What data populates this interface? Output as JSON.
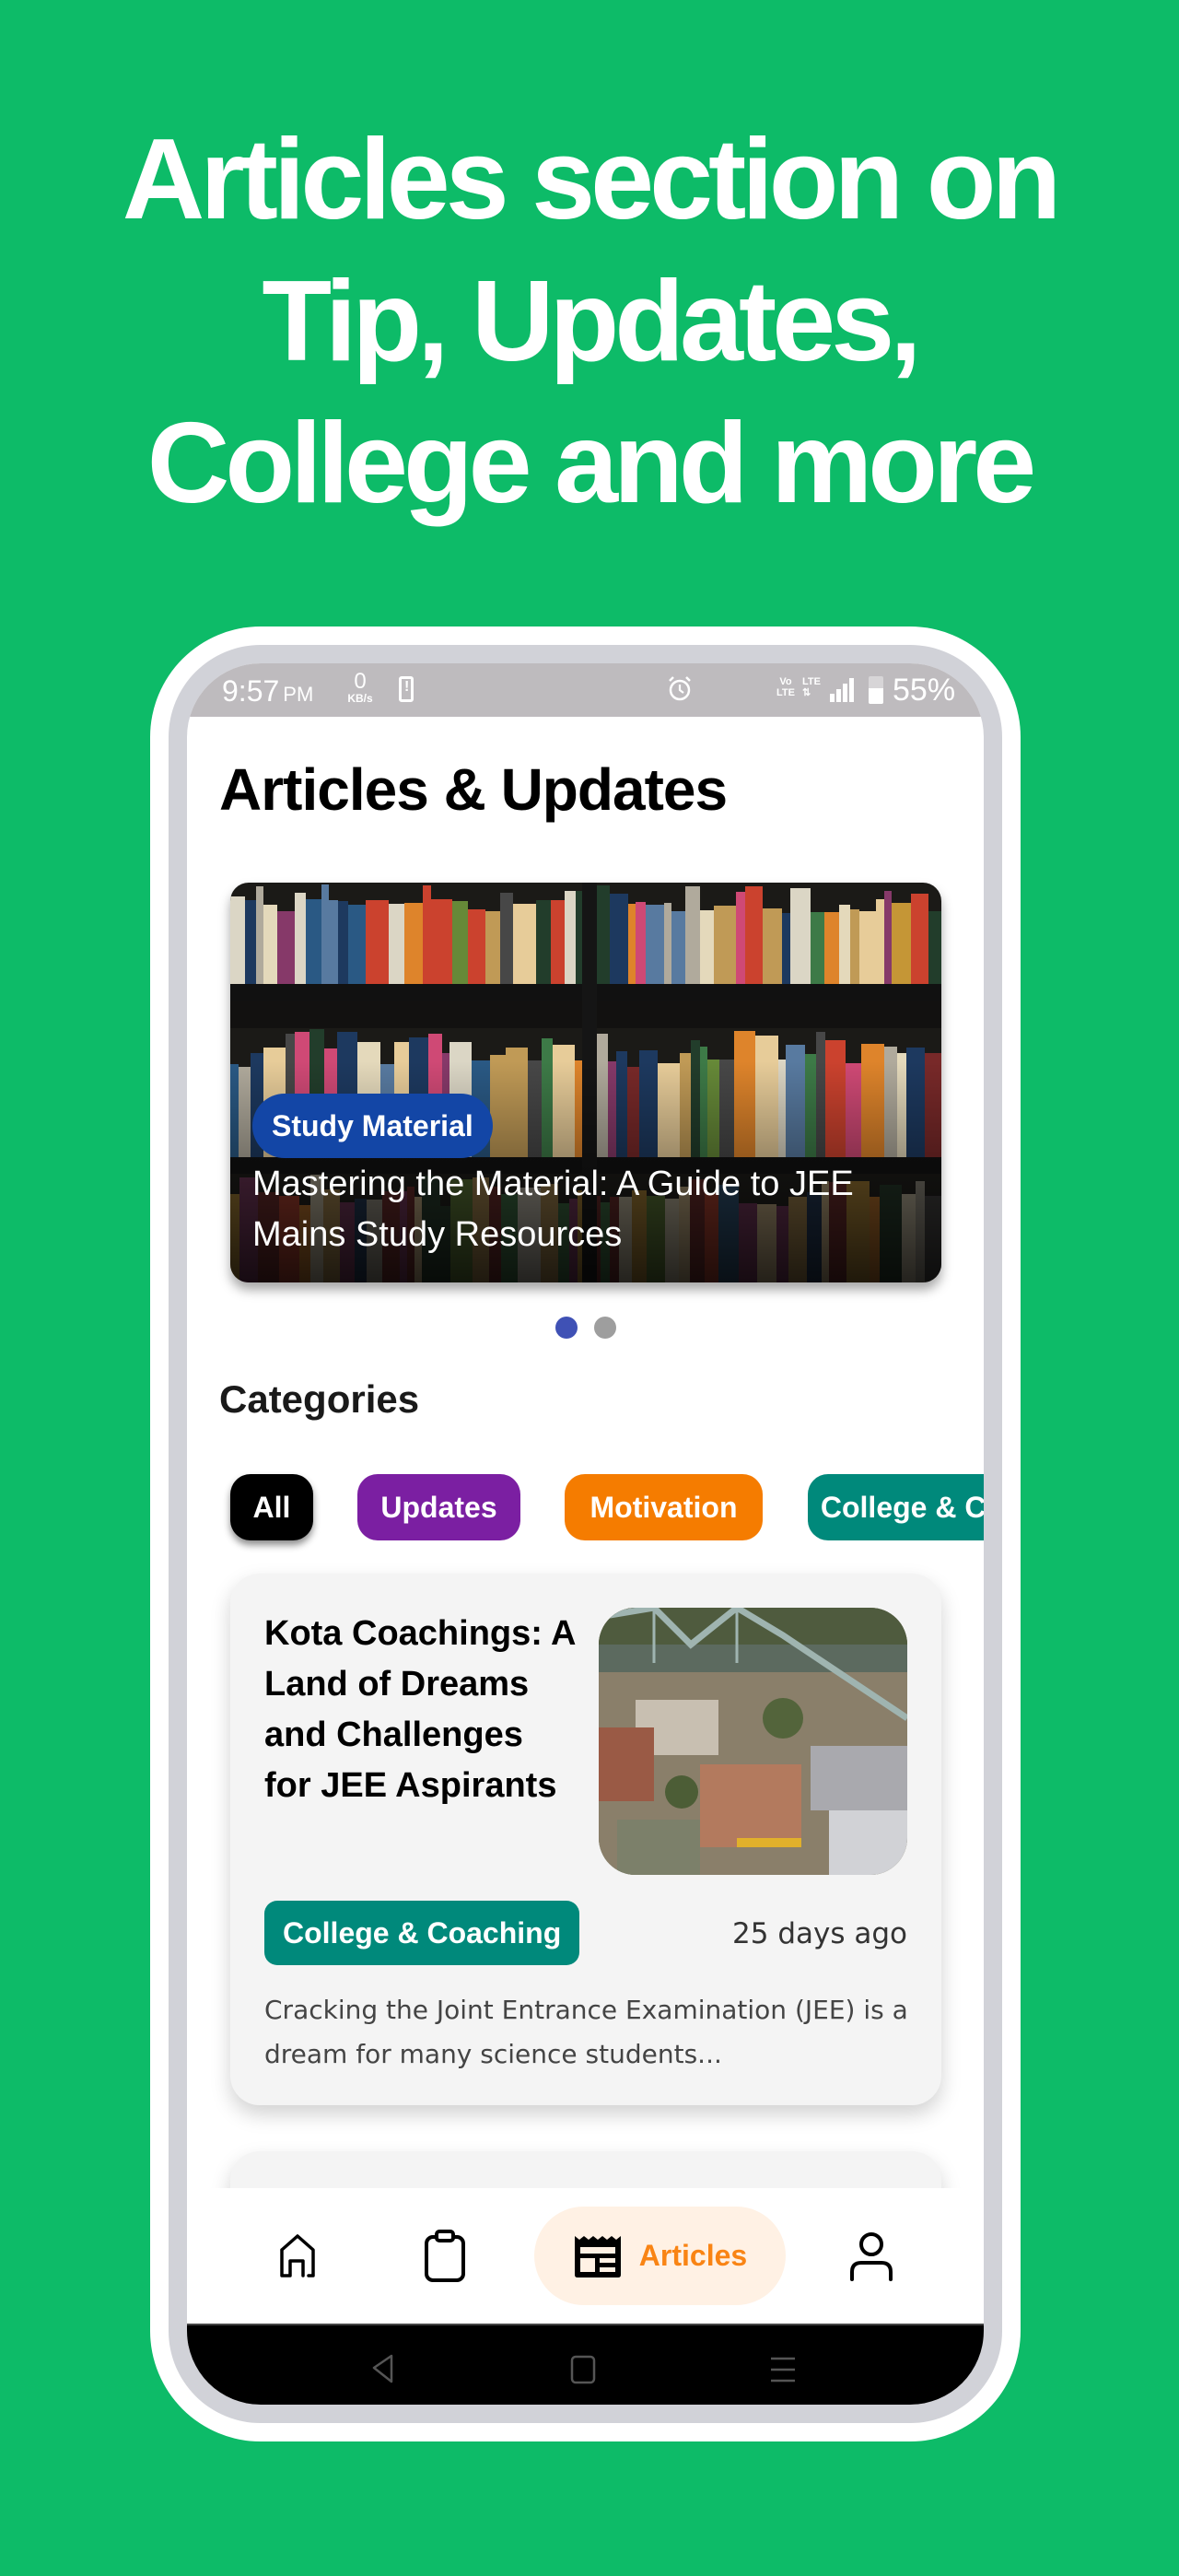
{
  "promo": {
    "headline_lines": [
      "Articles section on",
      "Tip, Updates,",
      "College and more"
    ]
  },
  "status_bar": {
    "time": "9:57",
    "ampm": "PM",
    "net_speed_value": "0",
    "net_speed_unit": "KB/s",
    "volte_top": "Vo",
    "volte_bottom": "LTE",
    "lte_label": "LTE",
    "battery_percent": "55%",
    "icons": [
      "phone-alert-icon",
      "alarm-icon",
      "volte-icon",
      "lte-data-icon",
      "signal-icon",
      "battery-icon"
    ]
  },
  "page": {
    "title": "Articles & Updates"
  },
  "carousel": {
    "slides": [
      {
        "category": "Study Material",
        "category_color": "#1346A6",
        "title_lines": [
          "Mastering the Material: A Guide to JEE",
          "Mains Study Resources"
        ]
      }
    ],
    "dot_count": 2,
    "active_index": 0
  },
  "categories": {
    "heading": "Categories",
    "items": [
      {
        "label": "All",
        "color": "#000000",
        "selected": true
      },
      {
        "label": "Updates",
        "color": "#7B1FA2",
        "selected": false
      },
      {
        "label": "Motivation",
        "color": "#F57C00",
        "selected": false
      },
      {
        "label": "College & Coaching",
        "color": "#00897B",
        "selected": false
      }
    ]
  },
  "articles": [
    {
      "title": "Kota Coachings: A Land of Dreams and Challenges for JEE Aspirants",
      "category": "College & Coaching",
      "category_color": "#00897B",
      "time_ago": "25 days ago",
      "excerpt": "Cracking the Joint Entrance Examination (JEE) is a dream for many science students..."
    }
  ],
  "bottom_nav": {
    "items": [
      {
        "name": "home",
        "icon": "home-icon",
        "label": ""
      },
      {
        "name": "tests",
        "icon": "clipboard-icon",
        "label": ""
      },
      {
        "name": "articles",
        "icon": "newspaper-icon",
        "label": "Articles",
        "active": true
      },
      {
        "name": "profile",
        "icon": "user-icon",
        "label": ""
      }
    ],
    "active_color": "#F98414",
    "active_bg": "#FFF1E4"
  },
  "system_nav": {
    "icons": [
      "back-icon",
      "home-square-icon",
      "recents-icon"
    ]
  },
  "colors": {
    "background": "#0DBB68",
    "status_bar": "#BEBBBE",
    "dot_active": "#3F51B5",
    "dot_inactive": "#9E9E9E"
  }
}
